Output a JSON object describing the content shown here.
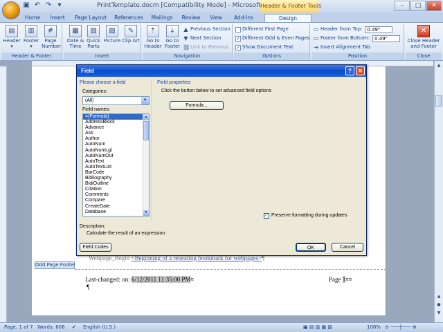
{
  "window": {
    "title": "PrintTemplate.docm [Compatibility Mode] - Microsoft Word",
    "context_tab_title": "Header & Footer Tools"
  },
  "tabs": [
    "Home",
    "Insert",
    "Page Layout",
    "References",
    "Mailings",
    "Review",
    "View",
    "Add-Ins",
    "Design"
  ],
  "ribbon": {
    "groups": {
      "header_footer": "Header & Footer",
      "insert": "Insert",
      "navigation": "Navigation",
      "options": "Options",
      "position": "Position",
      "close": "Close"
    },
    "header_btn": "Header",
    "footer_btn": "Footer",
    "page_number_btn": "Page Number",
    "date_time_btn": "Date & Time",
    "quick_parts_btn": "Quick Parts",
    "picture_btn": "Picture",
    "clip_art_btn": "Clip Art",
    "goto_header_btn": "Go to Header",
    "goto_footer_btn": "Go to Footer",
    "previous_section": "Previous Section",
    "next_section": "Next Section",
    "link_to_previous": "Link to Previous",
    "different_first_page": "Different First Page",
    "different_odd_even": "Different Odd & Even Pages",
    "show_document_text": "Show Document Text",
    "header_from_top_label": "Header from Top:",
    "header_from_top_value": "0.49\"",
    "footer_from_bottom_label": "Footer from Bottom:",
    "footer_from_bottom_value": "0.49\"",
    "insert_alignment_tab": "Insert Alignment Tab",
    "close_header_footer": "Close Header and Footer",
    "check_states": {
      "different_first_page": false,
      "different_odd_even": true,
      "show_document_text": true
    }
  },
  "document": {
    "bookmark_prefix": "Webpage_Begin",
    "bookmark_link": "<Beginning of a repeating bookmark for webpages>",
    "bookmark_suffix": "¶",
    "footer_tag": "Odd Page Footer",
    "last_changed_label": "Last-changed: on: ",
    "last_changed_value": "6/12/2011 11:35:00 PM",
    "last_changed_mark": "¤",
    "page_label": "Page ",
    "page_value": "1",
    "page_mark": "¤¤",
    "pilcrow": "¶"
  },
  "dialog": {
    "title": "Field",
    "choose_section": "Please choose a field",
    "categories_label": "Categories:",
    "categories_value": "(All)",
    "field_names_label": "Field names:",
    "field_names": [
      "=(Formula)",
      "AddressBlock",
      "Advance",
      "Ask",
      "Author",
      "AutoNum",
      "AutoNumLgl",
      "AutoNumOut",
      "AutoText",
      "AutoTextList",
      "BarCode",
      "Bibliography",
      "BidiOutline",
      "Citation",
      "Comments",
      "Compare",
      "CreateDate",
      "Database"
    ],
    "selected_field": "=(Formula)",
    "properties_section": "Field properties",
    "properties_hint": "Click the button below to set advanced field options",
    "formula_btn": "Formula...",
    "preserve_label": "Preserve formatting during updates",
    "preserve_checked": true,
    "description_label": "Description:",
    "description_text": "Calculate the result of an expression",
    "field_codes_btn": "Field Codes",
    "ok_btn": "OK",
    "cancel_btn": "Cancel"
  },
  "status": {
    "page": "Page: 1 of 7",
    "words": "Words: 606",
    "language": "English (U.S.)",
    "zoom": "108%"
  }
}
